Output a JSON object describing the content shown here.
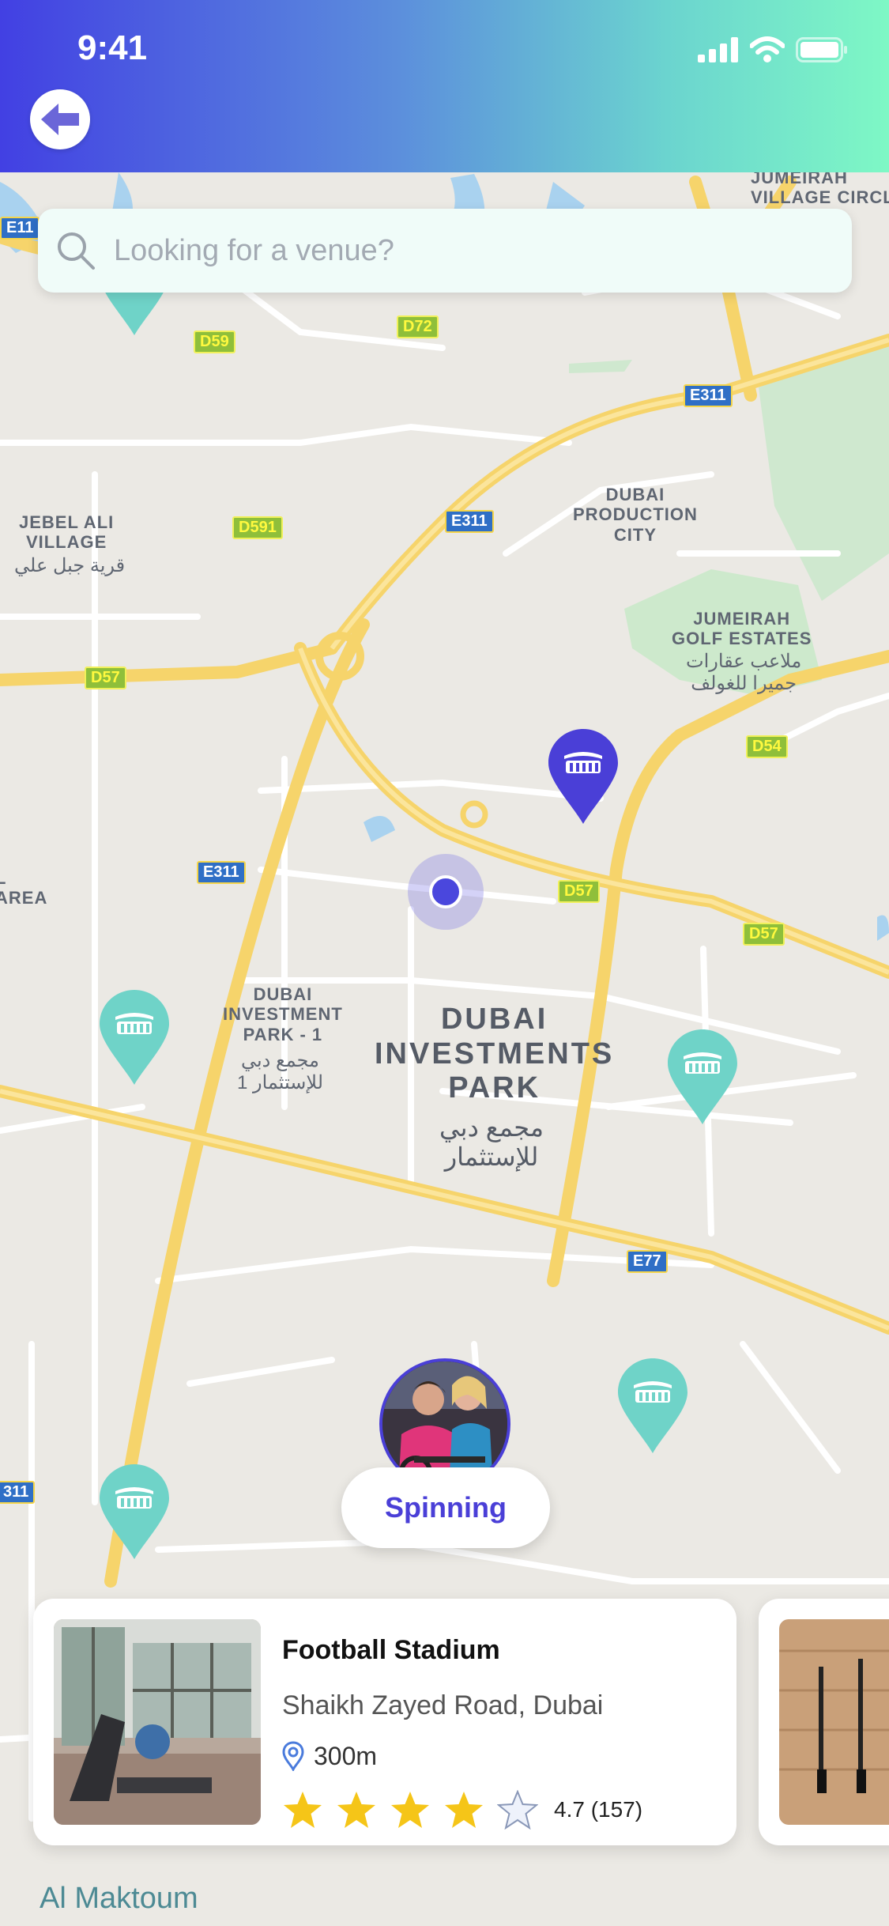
{
  "status_bar": {
    "time": "9:41"
  },
  "search": {
    "placeholder": "Looking for a venue?"
  },
  "map": {
    "labels": {
      "jumeirah_village": "JUMEIRAH\nVILLAGE CIRCLE",
      "jebel_ali": "JEBEL ALI\nVILLAGE",
      "jebel_ali_ar": "قرية جبل علي",
      "dubai_production": "DUBAI\nPRODUCTION\nCITY",
      "jumeirah_golf": "JUMEIRAH\nGOLF ESTATES",
      "jumeirah_golf_ar": "ملاعب عقارات\nجميرا للغولف",
      "dip1": "DUBAI\nINVESTMENT\nPARK - 1",
      "dip1_ar": "مجمع دبي\nللإستثمار 1",
      "dip": "DUBAI\nINVESTMENTS\nPARK",
      "dip_ar": "مجمع دبي\nللإستثمار",
      "left_area": "L\nAREA",
      "al_maktoum": "Al Maktoum"
    },
    "shields": {
      "d59": "D59",
      "d72": "D72",
      "e311_top": "E311",
      "d591": "D591",
      "e311_mid": "E311",
      "d57_left": "D57",
      "d54": "D54",
      "e311_left": "E311",
      "d57_mid": "D57",
      "d57_right": "D57",
      "e77": "E77",
      "e311_bottom": "311",
      "e11": "E11"
    }
  },
  "callout": {
    "label": "Spinning"
  },
  "venue_card": {
    "title": "Football Stadium",
    "address": "Shaikh Zayed Road, Dubai",
    "distance": "300m",
    "rating": 4,
    "rating_text": "4.7 (157)"
  },
  "colors": {
    "accent": "#4a3fd7",
    "marker_inactive": "#6fd3c8",
    "header_start": "#4240e3",
    "header_end": "#7ef8c5"
  }
}
